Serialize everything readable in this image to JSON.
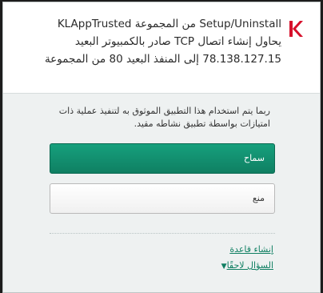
{
  "header": {
    "logo_icon": "kaspersky-k-logo",
    "title": "Setup/Uninstall من المجموعة KLAppTrusted يحاول إنشاء اتصال TCP صادر بالكمبيوتر البعيد 78.138.127.15 إلى المنفذ البعيد 80 من المجموعة"
  },
  "body": {
    "description": "ربما يتم استخدام هذا التطبيق الموثوق به لتنفيذ عملية ذات امتيازات بواسطة تطبيق نشاطه مقيد."
  },
  "buttons": {
    "allow_label": "سماح",
    "deny_label": "منع"
  },
  "links": {
    "create_rule_label": "إنشاء قاعدة",
    "ask_later_label": "السؤال لاحقًا",
    "ask_later_icon": "chevron-down-icon"
  },
  "colors": {
    "accent": "#0f7f62",
    "allow_button": "#13936f",
    "logo_red": "#d6102b"
  }
}
